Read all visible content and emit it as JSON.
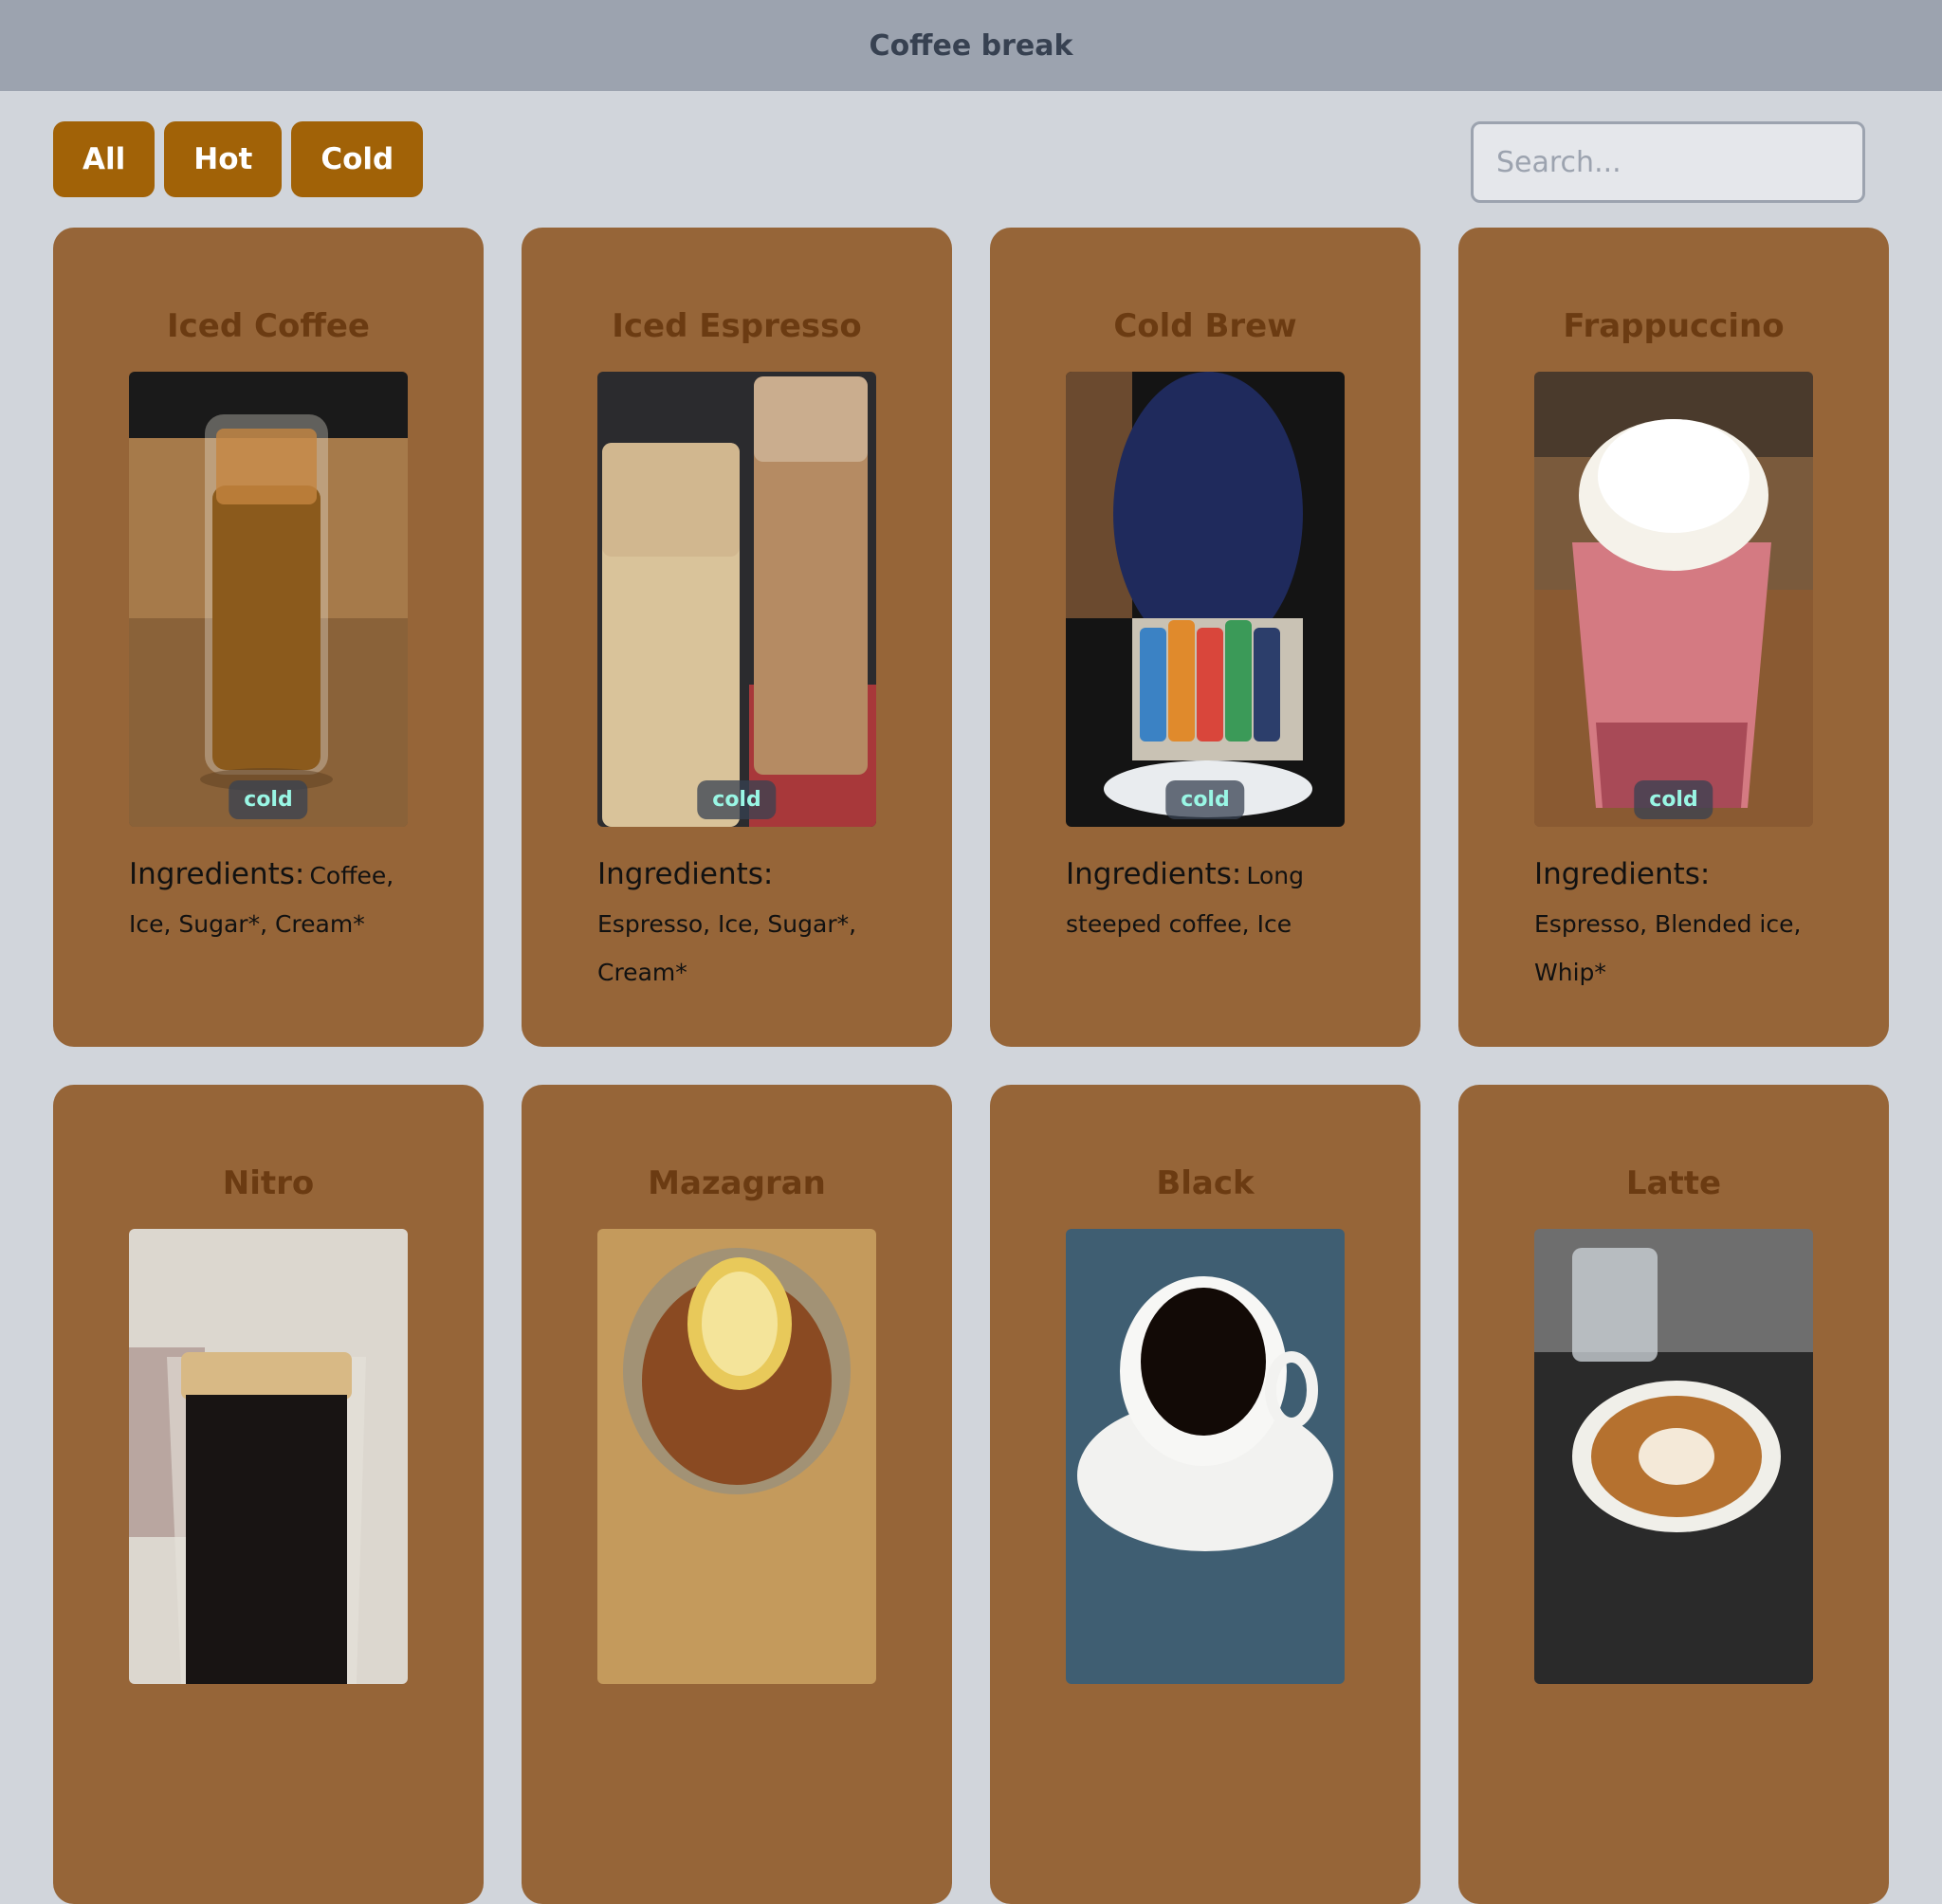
{
  "header": {
    "title": "Coffee break"
  },
  "filters": [
    {
      "label": "All"
    },
    {
      "label": "Hot"
    },
    {
      "label": "Cold"
    }
  ],
  "search": {
    "placeholder": "Search..."
  },
  "ingredients_label": "Ingredients:",
  "cards": [
    {
      "title": "Iced Coffee",
      "tag": "cold",
      "ingredients": "Coffee, Ice, Sugar*, Cream*"
    },
    {
      "title": "Iced Espresso",
      "tag": "cold",
      "ingredients": "Espresso, Ice, Sugar*, Cream*"
    },
    {
      "title": "Cold Brew",
      "tag": "cold",
      "ingredients": "Long steeped coffee, Ice"
    },
    {
      "title": "Frappuccino",
      "tag": "cold",
      "ingredients": "Espresso, Blended ice, Whip*"
    },
    {
      "title": "Nitro"
    },
    {
      "title": "Mazagran"
    },
    {
      "title": "Black"
    },
    {
      "title": "Latte"
    }
  ]
}
